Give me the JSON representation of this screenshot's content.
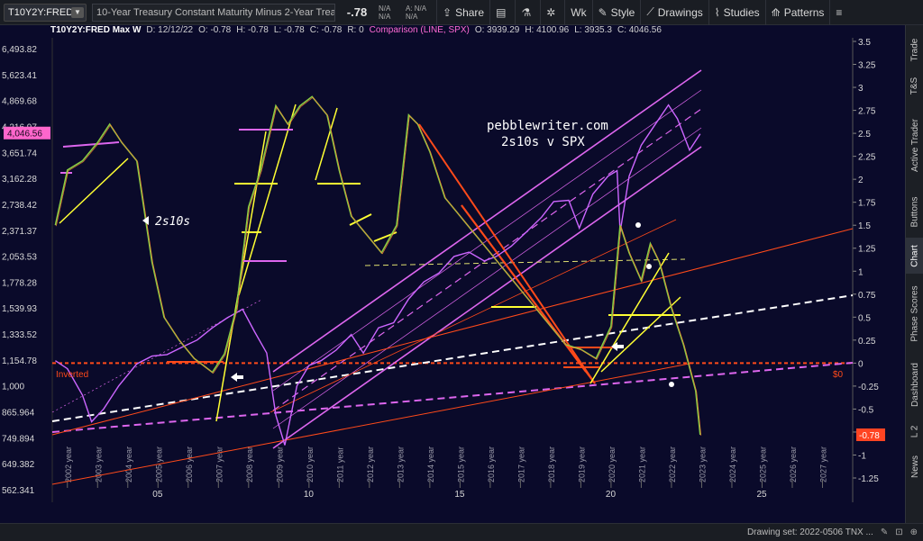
{
  "toolbar": {
    "symbol": "T10Y2Y:FRED",
    "description": "10-Year Treasury Constant Maturity Minus 2-Year Treas...",
    "last_price": "-.78",
    "bid_label": "N/A",
    "bid_sub": "N/A",
    "ask_label": "A: N/A",
    "ask_sub": "N/A",
    "share_label": "Share",
    "interval_label": "Wk",
    "style_label": "Style",
    "drawings_label": "Drawings",
    "studies_label": "Studies",
    "patterns_label": "Patterns"
  },
  "inforow": {
    "title": "T10Y2Y:FRED Max W",
    "date": "D: 12/12/22",
    "open": "O: -0.78",
    "high": "H: -0.78",
    "low": "L: -0.78",
    "close": "C: -0.78",
    "r": "R: 0",
    "comparison": "Comparison (LINE, SPX)",
    "c_open": "O: 3939.29",
    "c_high": "H: 4100.96",
    "c_low": "L: 3935.3",
    "c_close": "C: 4046.56"
  },
  "annotations": {
    "watermark_line1": "pebblewriter.com",
    "watermark_line2": "2s10s v SPX",
    "label_2s10s": "2s10s",
    "label_inverted": "Inverted",
    "label_zero": "$0"
  },
  "price_badges": {
    "left": "4,046.56",
    "right": "-0.78"
  },
  "colors": {
    "background": "#0a0a2a",
    "spx_line": "#cc66ff",
    "channel": "#dd66ee",
    "yellow": "#ffff33",
    "red": "#ff4a1a",
    "white_dash": "#ffffff",
    "badge_left": "#ff66cc",
    "badge_right": "#ff4422"
  },
  "chart_data": {
    "type": "line",
    "left_axis_ticks": [
      "6,493.82",
      "5,623.41",
      "4,869.68",
      "4,216.97",
      "3,651.74",
      "3,162.28",
      "2,738.42",
      "2,371.37",
      "2,053.53",
      "1,778.28",
      "1,539.93",
      "1,333.52",
      "1,154.78",
      "1,000",
      "865.964",
      "749.894",
      "649.382",
      "562.341"
    ],
    "right_axis_ticks": [
      "3.5",
      "3.25",
      "3",
      "2.75",
      "2.5",
      "2.25",
      "2",
      "1.75",
      "1.5",
      "1.25",
      "1",
      "0.75",
      "0.5",
      "0.25",
      "0",
      "-0.25",
      "-0.5",
      "-0.75",
      "-1",
      "-1.25"
    ],
    "x_year_labels": [
      "2002 year",
      "2003 year",
      "2004 year",
      "2005 year",
      "2006 year",
      "2007 year",
      "2008 year",
      "2009 year",
      "2010 year",
      "2011 year",
      "2012 year",
      "2013 year",
      "2014 year",
      "2015 year",
      "2016 year",
      "2017 year",
      "2018 year",
      "2019 year",
      "2020 year",
      "2021 year",
      "2022 year",
      "2023 year",
      "2024 year",
      "2025 year",
      "2026 year",
      "2027 year"
    ],
    "x_bottom_labels": [
      "05",
      "10",
      "15",
      "20",
      "25"
    ],
    "series": [
      {
        "name": "T10Y2Y",
        "axis": "right",
        "x": [
          2001.6,
          2002.0,
          2002.5,
          2003.0,
          2003.4,
          2003.8,
          2004.3,
          2004.8,
          2005.2,
          2005.7,
          2006.2,
          2006.8,
          2007.2,
          2007.6,
          2008.0,
          2008.4,
          2008.9,
          2009.3,
          2009.7,
          2010.1,
          2010.6,
          2011.0,
          2011.4,
          2011.9,
          2012.4,
          2012.9,
          2013.3,
          2013.6,
          2014.0,
          2014.5,
          2015.0,
          2015.5,
          2016.0,
          2016.5,
          2017.0,
          2017.5,
          2018.0,
          2018.5,
          2019.0,
          2019.5,
          2020.0,
          2020.3,
          2020.6,
          2021.0,
          2021.3,
          2021.6,
          2022.0,
          2022.4,
          2022.8,
          2022.95
        ],
        "y": [
          1.5,
          2.1,
          2.2,
          2.4,
          2.6,
          2.4,
          2.2,
          1.1,
          0.5,
          0.25,
          0.05,
          -0.1,
          0.1,
          0.6,
          1.7,
          2.1,
          2.8,
          2.6,
          2.8,
          2.9,
          2.7,
          2.1,
          1.6,
          1.4,
          1.2,
          1.5,
          2.7,
          2.6,
          2.3,
          1.8,
          1.6,
          1.4,
          1.2,
          1.0,
          0.8,
          0.6,
          0.4,
          0.2,
          0.15,
          0.05,
          0.4,
          1.5,
          1.2,
          0.9,
          1.3,
          1.1,
          0.6,
          0.2,
          -0.3,
          -0.78
        ]
      },
      {
        "name": "SPX",
        "axis": "left",
        "x": [
          2001.6,
          2002.0,
          2002.5,
          2002.8,
          2003.2,
          2003.7,
          2004.3,
          2004.8,
          2005.3,
          2005.8,
          2006.3,
          2006.8,
          2007.3,
          2007.8,
          2008.2,
          2008.6,
          2008.9,
          2009.2,
          2009.6,
          2010.0,
          2010.4,
          2010.9,
          2011.4,
          2011.8,
          2012.3,
          2012.8,
          2013.3,
          2013.8,
          2014.3,
          2014.8,
          2015.3,
          2015.8,
          2016.2,
          2016.7,
          2017.2,
          2017.7,
          2018.1,
          2018.6,
          2018.95,
          2019.4,
          2019.9,
          2020.2,
          2020.3,
          2020.6,
          2021.0,
          2021.4,
          2021.9,
          2022.2,
          2022.6,
          2022.95
        ],
        "y": [
          1150,
          1100,
          950,
          820,
          880,
          1000,
          1130,
          1180,
          1190,
          1240,
          1290,
          1380,
          1460,
          1530,
          1350,
          1200,
          850,
          720,
          1000,
          1120,
          1150,
          1220,
          1330,
          1200,
          1380,
          1420,
          1620,
          1780,
          1870,
          2050,
          2100,
          2000,
          2050,
          2170,
          2350,
          2550,
          2780,
          2800,
          2400,
          2900,
          3200,
          3300,
          2350,
          3200,
          3800,
          4200,
          4750,
          4400,
          3700,
          4046.56
        ]
      }
    ],
    "title": "T10Y2Y:FRED Max W",
    "legend": "Comparison (LINE, SPX)"
  },
  "sidebar": {
    "tabs": [
      "Trade",
      "T&S",
      "Active Trader",
      "Buttons",
      "Chart",
      "Phase Scores",
      "Dashboard",
      "L 2",
      "News"
    ],
    "active": "Chart"
  },
  "statusbar": {
    "drawing_set": "Drawing set: 2022-0506 TNX ..."
  }
}
